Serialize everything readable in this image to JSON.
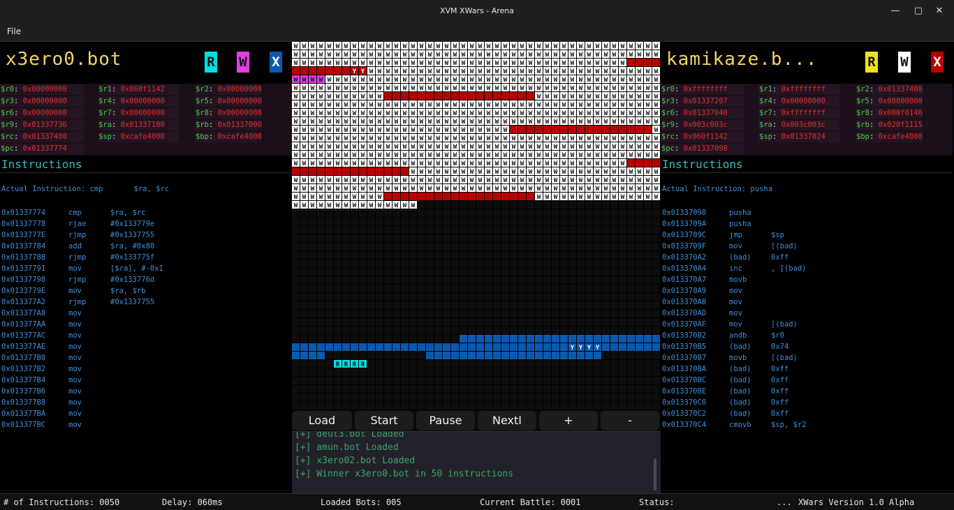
{
  "window": {
    "title": "XVM XWars - Arena",
    "min_glyph": "—",
    "max_glyph": "▢",
    "close_glyph": "✕"
  },
  "menu": {
    "file": "File"
  },
  "colors": {
    "accent_name": "#f0d860",
    "reg_name": "#3fd14a",
    "reg_value": "#e03030",
    "instruction": "#3f8fd8",
    "heading": "#2bbfc4",
    "bot1": "#b80000",
    "bot2": "#0a5ab0",
    "log": "#3aa56a"
  },
  "left_bot": {
    "name": "x3ero0.bot",
    "flags": [
      {
        "label": "R",
        "bg": "#00e0e0",
        "fg": "#111111"
      },
      {
        "label": "W",
        "bg": "#e040e0",
        "fg": "#111111"
      },
      {
        "label": "X",
        "bg": "#0a5ab0",
        "fg": "#ffffff"
      }
    ],
    "registers": [
      {
        "name": "$r0",
        "value": "0x00000000"
      },
      {
        "name": "$r1",
        "value": "0x060f1142"
      },
      {
        "name": "$r2",
        "value": "0x00000000"
      },
      {
        "name": "$r3",
        "value": "0x00000000"
      },
      {
        "name": "$r4",
        "value": "0x00000000"
      },
      {
        "name": "$r5",
        "value": "0x00000000"
      },
      {
        "name": "$r6",
        "value": "0x00000000"
      },
      {
        "name": "$r7",
        "value": "0x00000000"
      },
      {
        "name": "$r8",
        "value": "0x00000000"
      },
      {
        "name": "$r9",
        "value": "0x01337736"
      },
      {
        "name": "$ra",
        "value": "0x01337100"
      },
      {
        "name": "$rb",
        "value": "0x01337000"
      },
      {
        "name": "$rc",
        "value": "0x01337400"
      },
      {
        "name": "$sp",
        "value": "0xcafe4000"
      },
      {
        "name": "$bp",
        "value": "0xcafe4000"
      },
      {
        "name": "$pc",
        "value": "0x01337774"
      }
    ],
    "instructions_title": "Instructions",
    "actual_label": "Actual Instruction:",
    "actual_value": "cmp       $ra, $rc",
    "instructions": [
      {
        "addr": "0x01337774",
        "op": "cmp",
        "args": "$ra, $rc"
      },
      {
        "addr": "0x01337778",
        "op": "rjae",
        "args": "#0x133779e"
      },
      {
        "addr": "0x0133777E",
        "op": "rjmp",
        "args": "#0x1337755"
      },
      {
        "addr": "0x01337784",
        "op": "add",
        "args": "$ra, #0x80"
      },
      {
        "addr": "0x0133778B",
        "op": "rjmp",
        "args": "#0x133775f"
      },
      {
        "addr": "0x01337791",
        "op": "mov",
        "args": "[$ra], #-0x1"
      },
      {
        "addr": "0x01337798",
        "op": "rjmp",
        "args": "#0x133776d"
      },
      {
        "addr": "0x0133779E",
        "op": "mov",
        "args": "$ra, $rb"
      },
      {
        "addr": "0x013377A2",
        "op": "rjmp",
        "args": "#0x1337755"
      },
      {
        "addr": "0x013377A8",
        "op": "mov",
        "args": ""
      },
      {
        "addr": "0x013377AA",
        "op": "mov",
        "args": ""
      },
      {
        "addr": "0x013377AC",
        "op": "mov",
        "args": ""
      },
      {
        "addr": "0x013377AE",
        "op": "mov",
        "args": ""
      },
      {
        "addr": "0x013377B0",
        "op": "mov",
        "args": ""
      },
      {
        "addr": "0x013377B2",
        "op": "mov",
        "args": ""
      },
      {
        "addr": "0x013377B4",
        "op": "mov",
        "args": ""
      },
      {
        "addr": "0x013377B6",
        "op": "mov",
        "args": ""
      },
      {
        "addr": "0x013377B8",
        "op": "mov",
        "args": ""
      },
      {
        "addr": "0x013377BA",
        "op": "mov",
        "args": ""
      },
      {
        "addr": "0x013377BC",
        "op": "mov",
        "args": ""
      }
    ]
  },
  "right_bot": {
    "name": "kamikaze.b...",
    "flags": [
      {
        "label": "R",
        "bg": "#f0e020",
        "fg": "#111111"
      },
      {
        "label": "W",
        "bg": "#ffffff",
        "fg": "#111111"
      },
      {
        "label": "X",
        "bg": "#b80000",
        "fg": "#ffffff"
      }
    ],
    "registers": [
      {
        "name": "$r0",
        "value": "0xffffffff"
      },
      {
        "name": "$r1",
        "value": "0xffffffff"
      },
      {
        "name": "$r2",
        "value": "0x01337400"
      },
      {
        "name": "$r3",
        "value": "0x01337207"
      },
      {
        "name": "$r4",
        "value": "0x00000000"
      },
      {
        "name": "$r5",
        "value": "0x00000000"
      },
      {
        "name": "$r6",
        "value": "0x01337040"
      },
      {
        "name": "$r7",
        "value": "0xffffffff"
      },
      {
        "name": "$r8",
        "value": "0x000f0146"
      },
      {
        "name": "$r9",
        "value": "0x003c003c"
      },
      {
        "name": "$ra",
        "value": "0x003c003c"
      },
      {
        "name": "$rb",
        "value": "0x020f1115"
      },
      {
        "name": "$rc",
        "value": "0x060f1142"
      },
      {
        "name": "$sp",
        "value": "0x01337024"
      },
      {
        "name": "$bp",
        "value": "0xcafe4000"
      },
      {
        "name": "$pc",
        "value": "0x01337098"
      }
    ],
    "instructions_title": "Instructions",
    "actual_label": "Actual Instruction:",
    "actual_value": "pusha",
    "instructions": [
      {
        "addr": "0x01337098",
        "op": "pusha",
        "args": ""
      },
      {
        "addr": "0x0133709A",
        "op": "pusha",
        "args": ""
      },
      {
        "addr": "0x0133709C",
        "op": "jmp",
        "args": "$sp"
      },
      {
        "addr": "0x0133709F",
        "op": "mov",
        "args": "[(bad)"
      },
      {
        "addr": "0x013370A2",
        "op": "(bad)",
        "args": "0xff"
      },
      {
        "addr": "0x013370A4",
        "op": "inc",
        "args": ", [(bad)"
      },
      {
        "addr": "0x013370A7",
        "op": "movb",
        "args": ""
      },
      {
        "addr": "0x013370A9",
        "op": "mov",
        "args": ""
      },
      {
        "addr": "0x013370AB",
        "op": "mov",
        "args": ""
      },
      {
        "addr": "0x013370AD",
        "op": "mov",
        "args": ""
      },
      {
        "addr": "0x013370AF",
        "op": "mov",
        "args": "[(bad)"
      },
      {
        "addr": "0x013370B2",
        "op": "andb",
        "args": "$r0"
      },
      {
        "addr": "0x013370B5",
        "op": "(bad)",
        "args": "0x74"
      },
      {
        "addr": "0x013370B7",
        "op": "movb",
        "args": "[(bad)"
      },
      {
        "addr": "0x013370BA",
        "op": "(bad)",
        "args": "0xff"
      },
      {
        "addr": "0x013370BC",
        "op": "(bad)",
        "args": "0xff"
      },
      {
        "addr": "0x013370BE",
        "op": "(bad)",
        "args": "0xff"
      },
      {
        "addr": "0x013370C0",
        "op": "(bad)",
        "args": "0xff"
      },
      {
        "addr": "0x013370C2",
        "op": "(bad)",
        "args": "0xff"
      },
      {
        "addr": "0x013370C4",
        "op": "cmovb",
        "args": "$sp, $r2"
      }
    ]
  },
  "arena": {
    "cell_glyph_written": "W",
    "cell_glyph_exec": "Y",
    "cell_glyph_read": "R"
  },
  "controls": {
    "load": "Load",
    "start": "Start",
    "pause": "Pause",
    "next": "NextI",
    "plus": "+",
    "minus": "-"
  },
  "console": {
    "lines": [
      "[+] deut3.bot Loaded",
      "[+] amun.bot Loaded",
      "[+] x3ero02.bot Loaded",
      "[+] Winner x3ero0.bot in 50 instructions"
    ]
  },
  "status": {
    "instructions": "# of Instructions: 0050",
    "delay": "Delay: 060ms",
    "loaded": "Loaded Bots: 005",
    "battle": "Current Battle: 0001",
    "status": "Status:",
    "ellipsis": "...",
    "version": "XWars Version 1.0 Alpha"
  }
}
